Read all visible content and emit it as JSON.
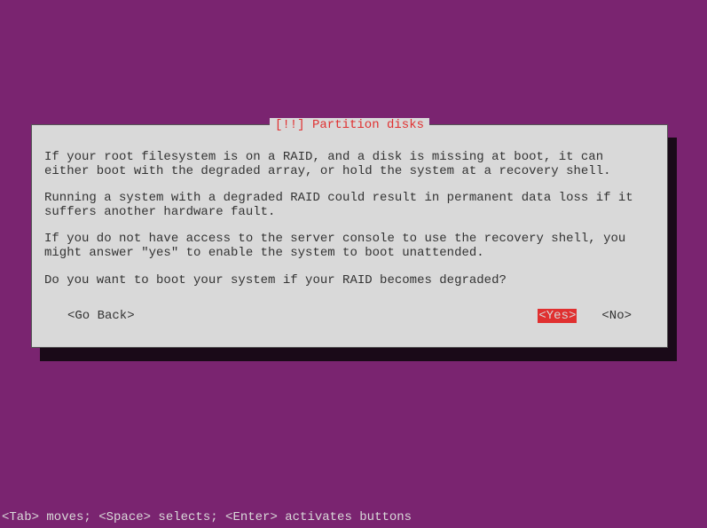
{
  "dialog": {
    "title_prefix": "[!!]",
    "title": "Partition disks",
    "paragraphs": [
      "If your root filesystem is on a RAID, and a disk is missing at boot, it can either boot with the degraded array, or hold the system at a recovery shell.",
      "Running a system with a degraded RAID could result in permanent data loss if it suffers another hardware fault.",
      "If you do not have access to the server console to use the recovery shell, you might answer \"yes\" to enable the system to boot unattended."
    ],
    "question": "Do you want to boot your system if your RAID becomes degraded?",
    "buttons": {
      "go_back": "<Go Back>",
      "yes": "<Yes>",
      "no": "<No>"
    },
    "selected_button": "yes"
  },
  "footer": {
    "help_text": "<Tab> moves; <Space> selects; <Enter> activates buttons"
  },
  "colors": {
    "background": "#7a2470",
    "dialog_bg": "#d9d9d9",
    "accent": "#e03030",
    "text": "#333",
    "footer_text": "#d9d9d9",
    "shadow": "#1a0a18"
  }
}
